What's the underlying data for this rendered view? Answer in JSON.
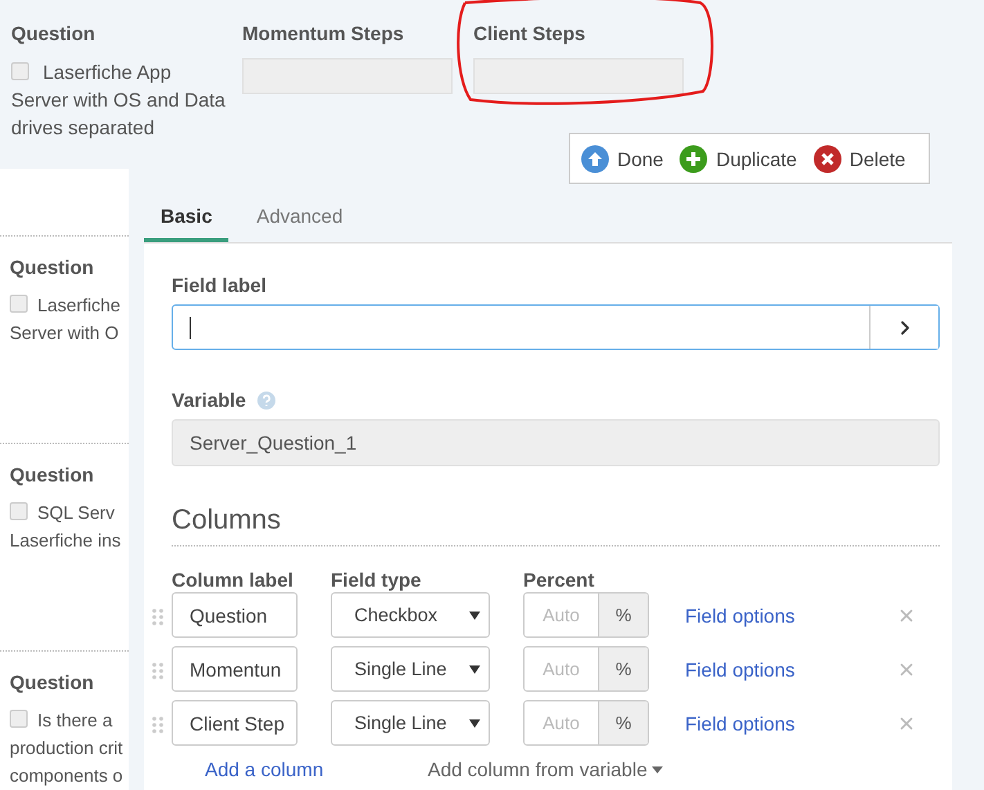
{
  "top": {
    "question": {
      "heading": "Question",
      "checked": false,
      "lines": [
        "Laserfiche App",
        "Server with OS and Data",
        "drives separated"
      ]
    },
    "fields": [
      {
        "label": "Momentum Steps",
        "annotated": false
      },
      {
        "label": "Client Steps",
        "annotated": true
      }
    ]
  },
  "toolbar": [
    {
      "kind": "up",
      "label": "Done"
    },
    {
      "kind": "add",
      "label": "Duplicate"
    },
    {
      "kind": "delete",
      "label": "Delete"
    }
  ],
  "questions": [
    {
      "heading": "Question",
      "checked": false,
      "lines": [
        "Laserfiche",
        "Server with O"
      ]
    },
    {
      "heading": "Question",
      "checked": false,
      "lines": [
        "SQL Serv",
        "Laserfiche ins"
      ]
    },
    {
      "heading": "Question",
      "checked": false,
      "lines": [
        "Is there a",
        "production crit",
        "components o"
      ]
    }
  ],
  "tabs": [
    {
      "label": "Basic",
      "selected": true
    },
    {
      "label": "Advanced",
      "selected": false
    }
  ],
  "field_label": {
    "label": "Field label",
    "focused": true
  },
  "variable": {
    "label": "Variable",
    "value": "Server_Question_1"
  },
  "columns": {
    "title": "Columns",
    "headers": [
      "Column label",
      "Field type",
      "Percent"
    ],
    "rows": [
      {
        "label": "Question",
        "type": "Checkbox",
        "percent_placeholder": "Auto",
        "unit": "%",
        "link": "Field options"
      },
      {
        "label": "Momentun",
        "type": "Single Line",
        "percent_placeholder": "Auto",
        "unit": "%",
        "link": "Field options"
      },
      {
        "label": "Client Step",
        "type": "Single Line",
        "percent_placeholder": "Auto",
        "unit": "%",
        "link": "Field options"
      }
    ],
    "add_link": "Add a column",
    "add_from_variable": "Add column from variable"
  }
}
